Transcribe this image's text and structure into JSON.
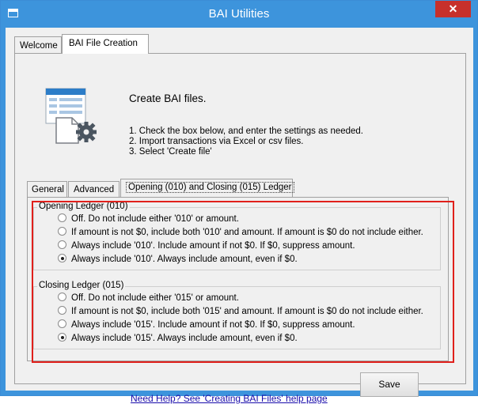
{
  "window": {
    "title": "BAI Utilities",
    "close_glyph": "✕"
  },
  "outer_tabs": [
    "Welcome",
    "BAI File Creation"
  ],
  "header": {
    "title": "Create BAI files.",
    "steps": [
      "1. Check the box below, and enter the settings as needed.",
      "2. Import transactions via Excel or csv files.",
      "3. Select 'Create file'"
    ]
  },
  "inner_tabs": [
    "General",
    "Advanced",
    "Opening (010) and Closing (015) Ledger"
  ],
  "opening": {
    "legend": "Opening Ledger (010)",
    "options": [
      "Off.  Do not include either '010' or amount.",
      "If amount is not $0, include both '010' and amount.  If amount is $0 do not include either.",
      "Always include '010'.  Include amount if not $0.  If $0, suppress amount.",
      "Always include '010'.  Always include amount, even if $0."
    ],
    "selected_index": 3
  },
  "closing": {
    "legend": "Closing Ledger (015)",
    "options": [
      "Off.  Do not include either '015' or amount.",
      "If amount is not $0, include both '015' and amount.  If amount is $0 do not include either.",
      "Always include '015'.  Include amount if not $0.  If $0, suppress amount.",
      "Always include '015'.  Always include amount, even if $0."
    ],
    "selected_index": 3
  },
  "buttons": {
    "save": "Save"
  },
  "help_link": "Need Help? See 'Creating BAI Files' help page",
  "colors": {
    "titlebar": "#3d94dc",
    "close": "#c7302b",
    "highlight": "#e0201b",
    "link": "#1a0dab"
  },
  "icons": [
    "app-window-icon",
    "document-settings-icon"
  ]
}
